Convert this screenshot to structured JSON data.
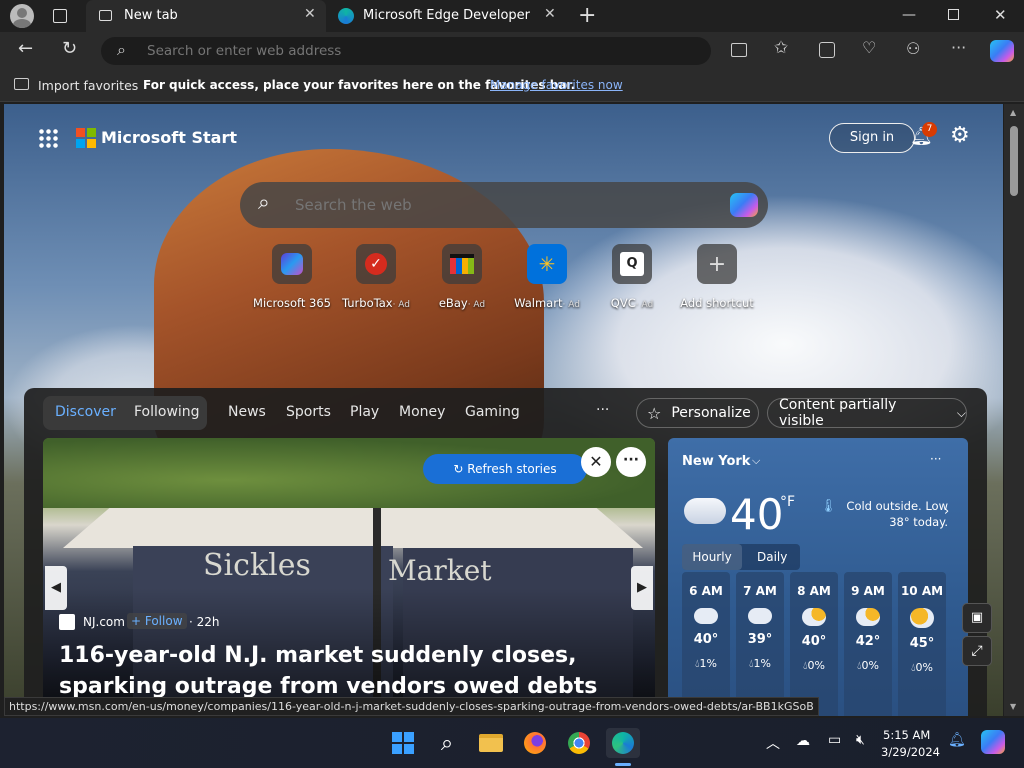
{
  "tabs": [
    {
      "label": "New tab"
    },
    {
      "label": "Microsoft Edge Developer"
    }
  ],
  "omnibox": {
    "placeholder": "Search or enter web address"
  },
  "favorites_bar": {
    "import_label": "Import favorites",
    "message": "For quick access, place your favorites here on the favorites bar.",
    "manage_link": "Manage favorites now"
  },
  "header": {
    "brand": "Microsoft Start",
    "sign_in": "Sign in",
    "notification_count": "7"
  },
  "search": {
    "placeholder": "Search the web"
  },
  "shortcuts": [
    {
      "label": "Microsoft 365",
      "ad": ""
    },
    {
      "label": "TurboTax",
      "ad": "· Ad"
    },
    {
      "label": "eBay",
      "ad": "· Ad"
    },
    {
      "label": "Walmart",
      "ad": "· Ad"
    },
    {
      "label": "QVC",
      "ad": "· Ad"
    },
    {
      "label": "Add shortcut",
      "ad": ""
    }
  ],
  "feed_nav": {
    "discover": "Discover",
    "following": "Following",
    "items": [
      "News",
      "Sports",
      "Play",
      "Money",
      "Gaming"
    ],
    "more": "···",
    "personalize": "Personalize",
    "visibility": "Content partially visible"
  },
  "hero": {
    "refresh": "Refresh stories",
    "source": "NJ.com",
    "follow": "+ Follow",
    "age": "· 22h",
    "headline": "116-year-old N.J. market suddenly closes, sparking outrage from vendors owed debts",
    "sign_text_1": "Sickles",
    "sign_text_2": "Market"
  },
  "weather": {
    "location": "New York",
    "temp": "40",
    "unit": "°F",
    "summary": "Cold outside. Low 38° today.",
    "tab_hourly": "Hourly",
    "tab_daily": "Daily",
    "hours": [
      {
        "time": "6 AM",
        "temp": "40°",
        "precip": "1%"
      },
      {
        "time": "7 AM",
        "temp": "39°",
        "precip": "1%"
      },
      {
        "time": "8 AM",
        "temp": "40°",
        "precip": "0%"
      },
      {
        "time": "9 AM",
        "temp": "42°",
        "precip": "0%"
      },
      {
        "time": "10 AM",
        "temp": "45°",
        "precip": "0%"
      }
    ]
  },
  "status_url": "https://www.msn.com/en-us/money/companies/116-year-old-n-j-market-suddenly-closes-sparking-outrage-from-vendors-owed-debts/ar-BB1kGSoB",
  "taskbar": {
    "time": "5:15 AM",
    "date": "3/29/2024"
  },
  "colors": {
    "accent": "#1a6fd6",
    "link": "#8ab4f8",
    "badge": "#d83b01"
  }
}
